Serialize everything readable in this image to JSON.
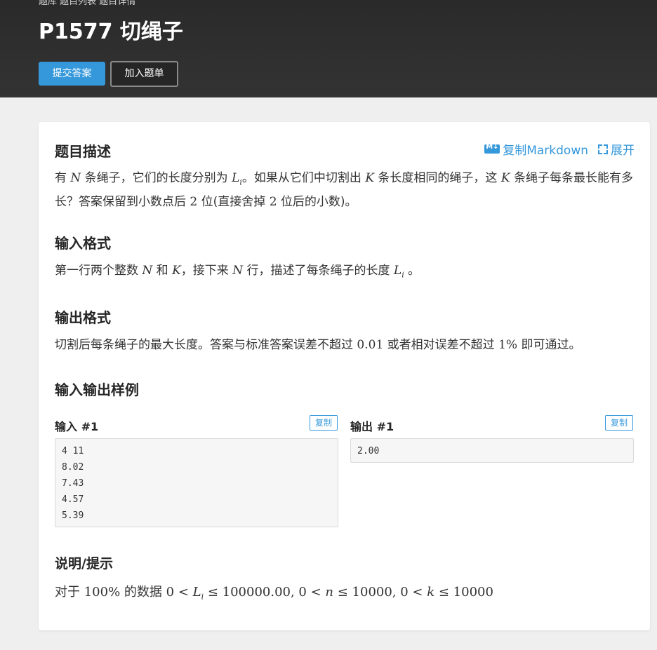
{
  "header": {
    "breadcrumb": "题库  题目列表  题目详情",
    "title": "P1577 切绳子",
    "submit_label": "提交答案",
    "add_list_label": "加入题单"
  },
  "actions": {
    "copy_markdown": "复制Markdown",
    "expand": "展开"
  },
  "description": {
    "heading": "题目描述",
    "t1": "有 ",
    "m_N": "N",
    "t2": " 条绳子，它们的长度分别为 ",
    "m_L": "L",
    "m_i": "i",
    "t3": "。如果从它们中切割出 ",
    "m_K": "K",
    "t4": " 条长度相同的绳子，这 ",
    "m_K2": "K",
    "t5": " 条绳子每条最长能有多长？答案保留到小数点后 ",
    "m_2a": "2",
    "t6": " 位(直接舍掉 ",
    "m_2b": "2",
    "t7": " 位后的小数)。"
  },
  "input_format": {
    "heading": "输入格式",
    "t1": "第一行两个整数 ",
    "m_N": "N",
    "t2": " 和 ",
    "m_K": "K",
    "t3": "，接下来 ",
    "m_N2": "N",
    "t4": " 行，描述了每条绳子的长度 ",
    "m_L": "L",
    "m_i": "i",
    "t5": " 。"
  },
  "output_format": {
    "heading": "输出格式",
    "t1": "切割后每条绳子的最大长度。答案与标准答案误差不超过 ",
    "m_001": "0.01",
    "t2": " 或者相对误差不超过 ",
    "m_pct": "1%",
    "t3": " 即可通过。"
  },
  "samples": {
    "heading": "输入输出样例",
    "input_label": "输入 #1",
    "output_label": "输出 #1",
    "copy_label": "复制",
    "input_lines": [
      "4 11",
      "8.02",
      "7.43",
      "4.57",
      "5.39"
    ],
    "output_lines": [
      "2.00"
    ]
  },
  "hint": {
    "heading": "说明/提示",
    "t1": "对于 ",
    "m_pct": "100%",
    "t2": " 的数据 ",
    "m_expr1": "0 < ",
    "m_L": "L",
    "m_i": "i",
    "m_expr2": " ≤ 100000.00, 0 < ",
    "m_n": "n",
    "m_expr3": " ≤ 10000, 0 < ",
    "m_k": "k",
    "m_expr4": " ≤ 10000"
  },
  "colors": {
    "accent": "#3498db",
    "header_bg": "#2f2f2f",
    "page_bg": "#efefef"
  }
}
